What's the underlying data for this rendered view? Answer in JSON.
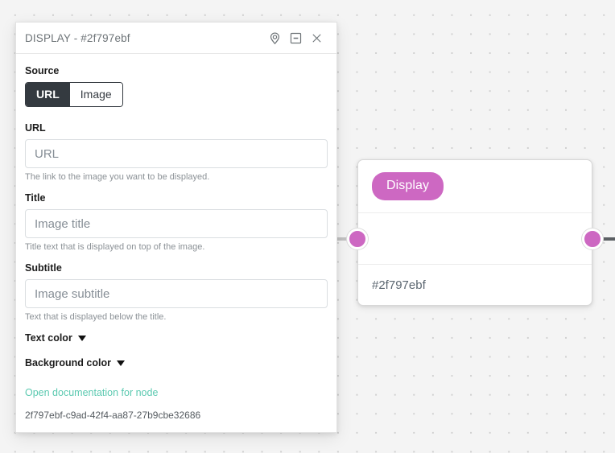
{
  "panel": {
    "title": "DISPLAY - #2f797ebf",
    "header_buttons": [
      {
        "name": "locate-node-button",
        "icon": "location-pin-icon"
      },
      {
        "name": "minimize-panel-button",
        "icon": "minimize-icon"
      },
      {
        "name": "close-panel-button",
        "icon": "close-icon"
      }
    ],
    "source": {
      "label": "Source",
      "options": [
        "URL",
        "Image"
      ],
      "selected": "URL"
    },
    "fields": [
      {
        "label": "URL",
        "value": "",
        "placeholder": "URL",
        "helper": "The link to the image you want to be displayed."
      },
      {
        "label": "Title",
        "value": "",
        "placeholder": "Image title",
        "helper": "Title text that is displayed on top of the image."
      },
      {
        "label": "Subtitle",
        "value": "",
        "placeholder": "Image subtitle",
        "helper": "Text that is displayed below the title."
      }
    ],
    "color_rows": [
      {
        "label": "Text color"
      },
      {
        "label": "Background color"
      }
    ],
    "doc_link": "Open documentation for node",
    "uuid": "2f797ebf-c9ad-42f4-aa87-27b9cbe32686",
    "link_color": "#5bc9b0"
  },
  "node": {
    "badge_label": "Display",
    "id_label": "#2f797ebf",
    "accent_color": "#cd68c2",
    "ports": [
      {
        "name": "node-input-port"
      },
      {
        "name": "node-output-port"
      }
    ]
  },
  "canvas": {
    "background_color": "#f4f4f4",
    "dot_color": "#d0d0d0"
  }
}
